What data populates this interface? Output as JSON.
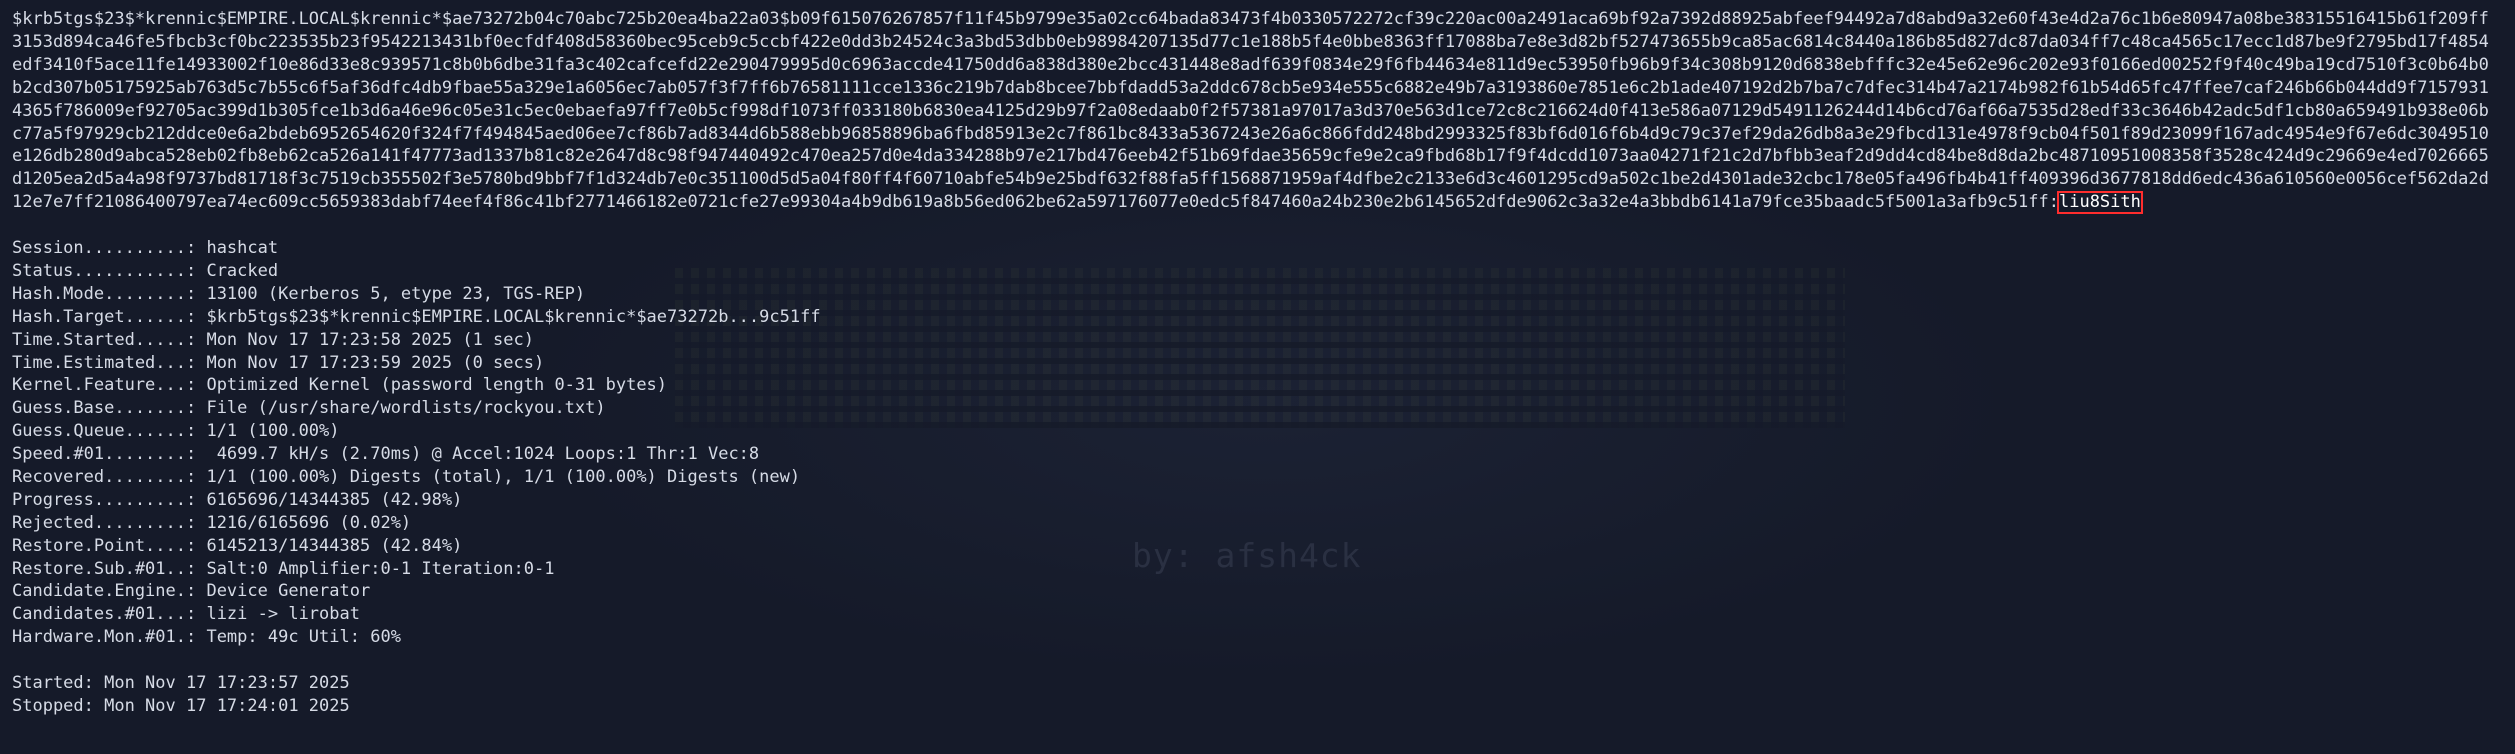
{
  "hash_output": {
    "hash_text": "$krb5tgs$23$*krennic$EMPIRE.LOCAL$krennic*$ae73272b04c70abc725b20ea4ba22a03$b09f615076267857f11f45b9799e35a02cc64bada83473f4b0330572272cf39c220ac00a2491aca69bf92a7392d88925abfeef94492a7d8abd9a32e60f43e4d2a76c1b6e80947a08be38315516415b61f209ff3153d894ca46fe5fbcb3cf0bc223535b23f9542213431bf0ecfdf408d58360bec95ceb9c5ccbf422e0dd3b24524c3a3bd53dbb0eb98984207135d77c1e188b5f4e0bbe8363ff17088ba7e8e3d82bf527473655b9ca85ac6814c8440a186b85d827dc87da034ff7c48ca4565c17ecc1d87be9f2795bd17f4854edf3410f5ace11fe14933002f10e86d33e8c939571c8b0b6dbe31fa3c402cafcefd22e290479995d0c6963accde41750dd6a838d380e2bcc431448e8adf639f0834e29f6fb44634e811d9ec53950fb96b9f34c308b9120d6838ebfffc32e45e62e96c202e93f0166ed00252f9f40c49ba19cd7510f3c0b64b0b2cd307b05175925ab763d5c7b55c6f5af36dfc4db9fbae55a329e1a6056ec7ab057f3f7ff6b76581111cce1336c219b7dab8bcee7bbfdadd53a2ddc678cb5e934e555c6882e49b7a3193860e7851e6c2b1ade407192d2b7ba7c7dfec314b47a2174b982f61b54d65fc47ffee7caf246b66b044dd9f71579314365f786009ef92705ac399d1b305fce1b3d6a46e96c05e31c5ec0ebaefa97ff7e0b5cf998df1073ff033180b6830ea4125d29b97f2a08edaab0f2f57381a97017a3d370e563d1ce72c8c216624d0f413e586a07129d5491126244d14b6cd76af66a7535d28edf33c3646b42adc5df1cb80a659491b938e06bc77a5f97929cb212ddce0e6a2bdeb6952654620f324f7f494845aed06ee7cf86b7ad8344d6b588ebb96858896ba6fbd85913e2c7f861bc8433a5367243e26a6c866fdd248bd2993325f83bf6d016f6b4d9c79c37ef29da26db8a3e29fbcd131e4978f9cb04f501f89d23099f167adc4954e9f67e6dc3049510e126db280d9abca528eb02fb8eb62ca526a141f47773ad1337b81c82e2647d8c98f947440492c470ea257d0e4da334288b97e217bd476eeb42f51b69fdae35659cfe9e2ca9fbd68b17f9f4dcdd1073aa04271f21c2d7bfbb3eaf2d9dd4cd84be8d8da2bc48710951008358f3528c424d9c29669e4ed7026665d1205ea2d5a4a98f9737bd81718f3c7519cb355502f3e5780bd9bbf7f1d324db7e0c351100d5d5a04f80ff4f60710abfe54b9e25bdf632f88fa5ff1568871959af4dfbe2c2133e6d3c4601295cd9a502c1be2d4301ade32cbc178e05fa496fb4b41ff409396d3677818dd6edc436a610560e0056cef562da2d12e7e7ff21086400797ea74ec609cc5659383dabf74eef4f86c41bf2771466182e0721cfe27e99304a4b9db619a8b56ed062be62a597176077e0edc5f847460a24b230e2b6145652dfde9062c3a32e4a3bbdb6141a79fce35baadc5f5001a3afb9c51ff:",
    "cracked_password": "liu8Sith"
  },
  "status": {
    "lines": [
      "Session..........: hashcat",
      "Status...........: Cracked",
      "Hash.Mode........: 13100 (Kerberos 5, etype 23, TGS-REP)",
      "Hash.Target......: $krb5tgs$23$*krennic$EMPIRE.LOCAL$krennic*$ae73272b...9c51ff",
      "Time.Started.....: Mon Nov 17 17:23:58 2025 (1 sec)",
      "Time.Estimated...: Mon Nov 17 17:23:59 2025 (0 secs)",
      "Kernel.Feature...: Optimized Kernel (password length 0-31 bytes)",
      "Guess.Base.......: File (/usr/share/wordlists/rockyou.txt)",
      "Guess.Queue......: 1/1 (100.00%)",
      "Speed.#01........:  4699.7 kH/s (2.70ms) @ Accel:1024 Loops:1 Thr:1 Vec:8",
      "Recovered........: 1/1 (100.00%) Digests (total), 1/1 (100.00%) Digests (new)",
      "Progress.........: 6165696/14344385 (42.98%)",
      "Rejected.........: 1216/6165696 (0.02%)",
      "Restore.Point....: 6145213/14344385 (42.84%)",
      "Restore.Sub.#01..: Salt:0 Amplifier:0-1 Iteration:0-1",
      "Candidate.Engine.: Device Generator",
      "Candidates.#01...: lizi -> lirobat",
      "Hardware.Mon.#01.: Temp: 49c Util: 60%"
    ]
  },
  "footer": {
    "started": "Started: Mon Nov 17 17:23:57 2025",
    "stopped": "Stopped: Mon Nov 17 17:24:01 2025"
  },
  "background": {
    "byline": "by: afsh4ck"
  },
  "colors": {
    "background": "#151a29",
    "text": "#d6dbe6",
    "highlight_box": "#ff2d2d"
  }
}
